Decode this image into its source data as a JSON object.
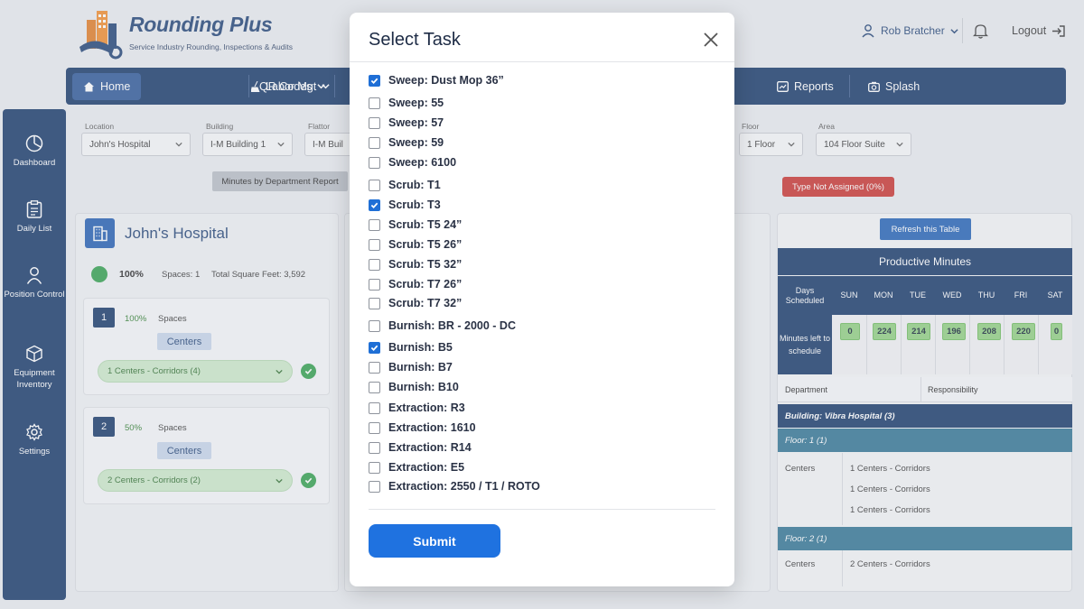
{
  "header": {
    "logo_title": "Rounding Plus",
    "logo_subtitle": "Service Industry Rounding, Inspections & Audits",
    "user_name": "Rob Bratcher",
    "logout_label": "Logout"
  },
  "nav": {
    "items": [
      {
        "label": "Home"
      },
      {
        "label": "Labor Mgt"
      },
      {
        "label": "QR Codes"
      },
      {
        "label": "Reports"
      },
      {
        "label": "Splash"
      }
    ]
  },
  "sidebar": {
    "items": [
      {
        "label": "Dashboard"
      },
      {
        "label": "Daily List"
      },
      {
        "label": "Position Control"
      },
      {
        "label": "Equipment Inventory"
      },
      {
        "label": "Settings"
      }
    ]
  },
  "filters": {
    "location": {
      "label": "Location",
      "value": "John's Hospital"
    },
    "building": {
      "label": "Building",
      "value": "I-M Building 1"
    },
    "floor_left": {
      "label": "Flattor",
      "value": "I-M Buil"
    },
    "floor": {
      "label": "Floor",
      "value": "1 Floor"
    },
    "area": {
      "label": "Area",
      "value": "104 Floor Suite"
    }
  },
  "buttons": {
    "minutes_report": "Minutes by Department Report",
    "type_not_assigned": "Type Not Assigned (0%)",
    "refresh": "Refresh this Table"
  },
  "left_panel": {
    "hospital": "John's Hospital",
    "percent": "100%",
    "spaces": "Spaces: 1",
    "total_sqft": "Total Square Feet: 3,592",
    "cards": [
      {
        "num": "1",
        "percent": "100%",
        "spaces_label": "Spaces",
        "tag": "Centers",
        "select": "1 Centers - Corridors (4)"
      },
      {
        "num": "2",
        "percent": "50%",
        "spaces_label": "Spaces",
        "tag": "Centers",
        "select": "2 Centers - Corridors (2)"
      }
    ]
  },
  "right_panel": {
    "title": "Productive Minutes",
    "days_scheduled": "Days Scheduled",
    "days": [
      "SUN",
      "MON",
      "TUE",
      "WED",
      "THU",
      "FRI",
      "SAT"
    ],
    "minutes_label": "Minutes left to schedule",
    "minutes": [
      "0",
      "224",
      "214",
      "196",
      "208",
      "220",
      "0"
    ],
    "dept_header": "Department",
    "resp_header": "Responsibility",
    "building_row": "Building: Vibra Hospital (3)",
    "floor1": "Floor: 1 (1)",
    "floor2": "Floor: 2 (1)",
    "centers": "Centers",
    "corridor1": "1 Centers - Corridors",
    "corridor2": "2 Centers - Corridors"
  },
  "modal": {
    "title": "Select Task",
    "submit": "Submit",
    "tasks": [
      {
        "label": "Sweep: Dust Mop 36”",
        "checked": true
      },
      {
        "label": "Sweep: 55",
        "checked": false
      },
      {
        "label": "Sweep: 57",
        "checked": false
      },
      {
        "label": "Sweep: 59",
        "checked": false
      },
      {
        "label": "Sweep: 6100",
        "checked": false
      },
      {
        "label": "Scrub: T1",
        "checked": false
      },
      {
        "label": "Scrub: T3",
        "checked": true
      },
      {
        "label": "Scrub: T5 24”",
        "checked": false
      },
      {
        "label": "Scrub: T5 26”",
        "checked": false
      },
      {
        "label": "Scrub: T5 32”",
        "checked": false
      },
      {
        "label": "Scrub: T7 26”",
        "checked": false
      },
      {
        "label": "Scrub: T7 32”",
        "checked": false
      },
      {
        "label": "Burnish: BR - 2000 - DC",
        "checked": false
      },
      {
        "label": "Burnish: B5",
        "checked": true
      },
      {
        "label": "Burnish: B7",
        "checked": false
      },
      {
        "label": "Burnish: B10",
        "checked": false
      },
      {
        "label": "Extraction: R3",
        "checked": false
      },
      {
        "label": "Extraction: 1610",
        "checked": false
      },
      {
        "label": "Extraction: R14",
        "checked": false
      },
      {
        "label": "Extraction: E5",
        "checked": false
      },
      {
        "label": "Extraction: 2550 / T1 / ROTO",
        "checked": false
      }
    ]
  }
}
